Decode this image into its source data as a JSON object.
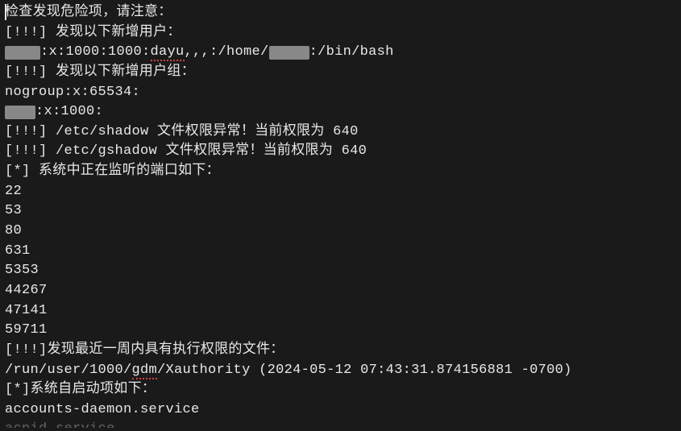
{
  "header": "检查发现危险项，请注意：",
  "alerts": {
    "new_users_label": "[!!!] 发现以下新增用户：",
    "user_entry_pre": ":x:1000:1000:",
    "user_entry_name": "dayu",
    "user_entry_mid": ",,,:/home/",
    "user_entry_post": ":/bin/bash",
    "new_groups_label": "[!!!] 发现以下新增用户组：",
    "group1": "nogroup:x:65534:",
    "group2_suffix": ":x:1000:",
    "shadow_alert": "[!!!] /etc/shadow 文件权限异常！当前权限为 640",
    "gshadow_alert": "[!!!] /etc/gshadow 文件权限异常！当前权限为 640"
  },
  "ports": {
    "label": "[*] 系统中正在监听的端口如下：",
    "list": [
      "22",
      "53",
      "80",
      "631",
      "5353",
      "44267",
      "47141",
      "59711"
    ]
  },
  "exec_files": {
    "label": "[!!!]发现最近一周内具有执行权限的文件：",
    "path_pre": "/run/user/1000/",
    "path_gdm": "gdm",
    "path_post": "/Xauthority",
    "timestamp": " (2024-05-12 07:43:31.874156881 -0700)"
  },
  "autostart": {
    "label": "[*]系统自启动项如下：",
    "items": [
      "accounts-daemon.service",
      "acpid.service"
    ]
  }
}
